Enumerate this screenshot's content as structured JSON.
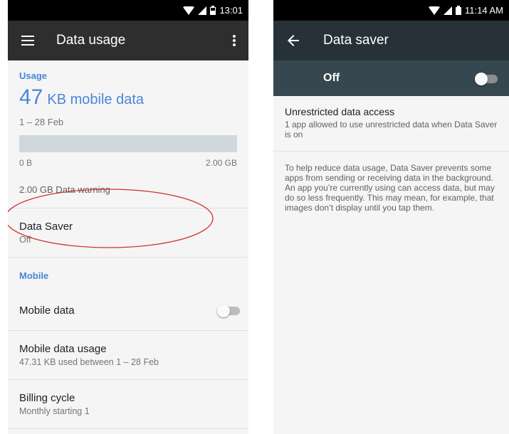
{
  "left": {
    "statusbar": {
      "time": "13:01"
    },
    "appbar": {
      "title": "Data usage"
    },
    "usage": {
      "section_label": "Usage",
      "amount_number": "47",
      "amount_unit": "KB mobile data",
      "date_range": "1 – 28 Feb",
      "bar_min_label": "0 B",
      "bar_max_label": "2.00 GB",
      "bar_fill_fraction": 0.0,
      "warning": "2.00 GB Data warning"
    },
    "data_saver": {
      "title": "Data Saver",
      "subtitle": "Off"
    },
    "mobile": {
      "section_label": "Mobile",
      "mobile_data_label": "Mobile data",
      "mobile_data_enabled": false,
      "usage_title": "Mobile data usage",
      "usage_subtitle": "47.31 KB used between 1 – 28 Feb",
      "billing_title": "Billing cycle",
      "billing_subtitle": "Monthly starting 1"
    },
    "annotation_color": "#d0312d"
  },
  "right": {
    "statusbar": {
      "time": "11:14 AM"
    },
    "appbar": {
      "title": "Data saver"
    },
    "switch": {
      "label": "Off",
      "enabled": false
    },
    "unrestricted": {
      "title": "Unrestricted data access",
      "subtitle": "1 app allowed to use unrestricted data when Data Saver is on"
    },
    "description": "To help reduce data usage, Data Saver prevents some apps from sending or receiving data in the background. An app you’re currently using can access data, but may do so less frequently. This may mean, for example, that images don’t display until you tap them."
  },
  "colors": {
    "accent": "#4a86d8",
    "left_appbar": "#2e2e2e",
    "right_appbar": "#263238",
    "right_switch_bar": "#37474f",
    "usage_bar": "#cfd8dc"
  },
  "icons": [
    "wifi-icon",
    "signal-icon",
    "battery-icon",
    "menu-icon",
    "more-vert-icon",
    "back-arrow-icon"
  ]
}
